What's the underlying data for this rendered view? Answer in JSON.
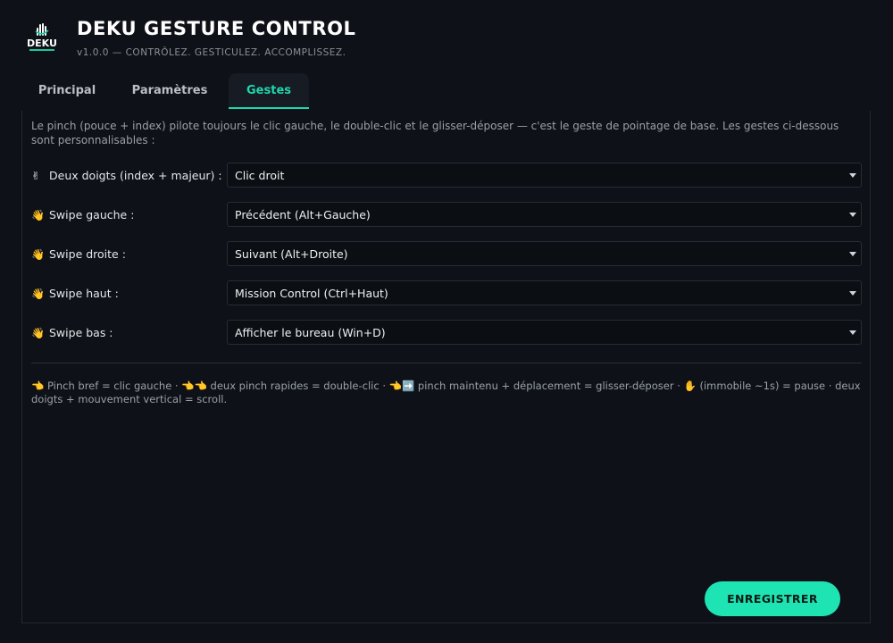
{
  "app": {
    "logo_text": "DEKU",
    "title": "DEKU GESTURE CONTROL",
    "subtitle": "v1.0.0 — CONTRÔLEZ. GESTICULEZ. ACCOMPLISSEZ."
  },
  "tabs": [
    {
      "label": "Principal",
      "active": false
    },
    {
      "label": "Paramètres",
      "active": false
    },
    {
      "label": "Gestes",
      "active": true
    }
  ],
  "gestures": {
    "intro": "Le pinch (pouce + index) pilote toujours le clic gauche, le double-clic et le glisser-déposer — c'est le geste de pointage de base. Les gestes ci-dessous sont personnalisables :",
    "rows": [
      {
        "icon": "✌",
        "icon_name": "victory-hand-icon",
        "label": "Deux doigts (index + majeur) :",
        "value": "Clic droit"
      },
      {
        "icon": "👋",
        "icon_name": "waving-hand-icon",
        "label": "Swipe gauche :",
        "value": "Précédent (Alt+Gauche)"
      },
      {
        "icon": "👋",
        "icon_name": "waving-hand-icon",
        "label": "Swipe droite :",
        "value": "Suivant (Alt+Droite)"
      },
      {
        "icon": "👋",
        "icon_name": "waving-hand-icon",
        "label": "Swipe haut :",
        "value": "Mission Control (Ctrl+Haut)"
      },
      {
        "icon": "👋",
        "icon_name": "waving-hand-icon",
        "label": "Swipe bas :",
        "value": "Afficher le bureau (Win+D)"
      }
    ],
    "note": "👈 Pinch bref = clic gauche · 👈👈 deux pinch rapides = double-clic · 👈➡️ pinch maintenu + déplacement = glisser-déposer · ✋ (immobile ~1s) = pause · deux doigts + mouvement vertical = scroll."
  },
  "actions": {
    "save_label": "ENREGISTRER"
  },
  "colors": {
    "accent": "#1ee3b3",
    "background": "#0e1117"
  }
}
